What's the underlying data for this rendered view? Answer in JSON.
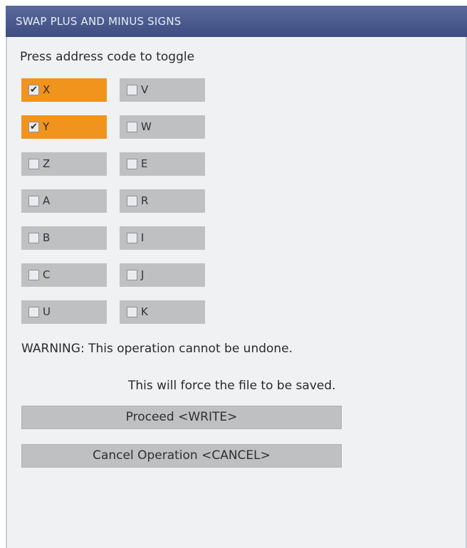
{
  "dialog": {
    "title": "SWAP PLUS AND MINUS SIGNS",
    "prompt": "Press address code to toggle",
    "checkmark_glyph": "✔",
    "colors": {
      "title_bar": "#4a5a8e",
      "checked": "#f0941e",
      "unchecked": "#bfc0c2",
      "background": "#f0f1f3"
    },
    "left_axes": [
      {
        "label": "X",
        "checked": true
      },
      {
        "label": "Y",
        "checked": true
      },
      {
        "label": "Z",
        "checked": false
      },
      {
        "label": "A",
        "checked": false
      },
      {
        "label": "B",
        "checked": false
      },
      {
        "label": "C",
        "checked": false
      },
      {
        "label": "U",
        "checked": false
      }
    ],
    "right_axes": [
      {
        "label": "V",
        "checked": false
      },
      {
        "label": "W",
        "checked": false
      },
      {
        "label": "E",
        "checked": false
      },
      {
        "label": "R",
        "checked": false
      },
      {
        "label": "I",
        "checked": false
      },
      {
        "label": "J",
        "checked": false
      },
      {
        "label": "K",
        "checked": false
      }
    ],
    "warning": "WARNING: This operation cannot be undone.",
    "force_save_note": "This will force the file to be saved.",
    "proceed_label": "Proceed <WRITE>",
    "cancel_label": "Cancel Operation <CANCEL>"
  }
}
